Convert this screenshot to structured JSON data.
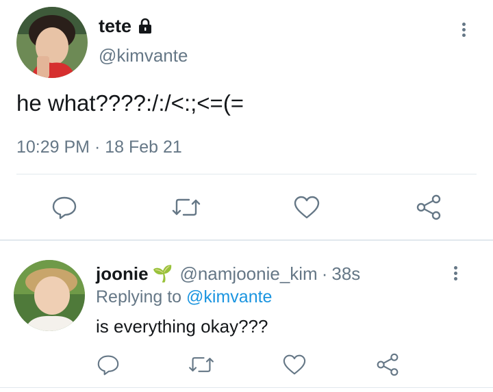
{
  "main_tweet": {
    "display_name": "tete",
    "handle": "@kimvante",
    "text": "he what????:/:/<:;<=(=",
    "timestamp": "10:29 PM · 18 Feb 21",
    "actions": [
      "reply",
      "retweet",
      "like",
      "share"
    ]
  },
  "reply_tweet": {
    "display_name": "joonie",
    "name_emoji": "🌱",
    "handle": "@namjoonie_kim",
    "time_sep": "·",
    "time": "38s",
    "replying_to_prefix": "Replying to",
    "replying_to_handle": "@kimvante",
    "text": "is everything okay???",
    "actions": [
      "reply",
      "retweet",
      "like",
      "share"
    ]
  },
  "colors": {
    "text": "#14171a",
    "muted": "#657786",
    "link": "#1b95e0",
    "divider": "#e1e8ed"
  }
}
